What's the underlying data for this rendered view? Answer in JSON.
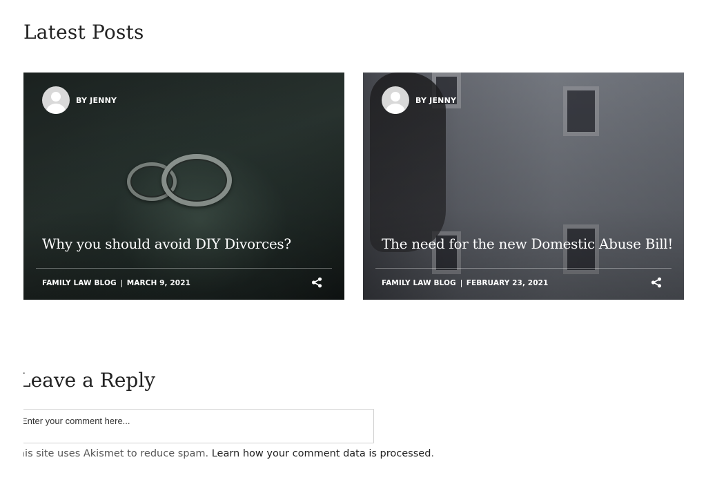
{
  "latest_posts": {
    "heading": "Latest Posts",
    "posts": [
      {
        "author": "BY JENNY",
        "title": "Why you should avoid DIY Divorces?",
        "category": "FAMILY LAW BLOG",
        "date": "MARCH 9, 2021",
        "share_icon": "share-icon"
      },
      {
        "author": "BY JENNY",
        "title": "The need for the new Domestic Abuse Bill!",
        "category": "FAMILY LAW BLOG",
        "date": "FEBRUARY 23, 2021",
        "share_icon": "share-icon"
      }
    ]
  },
  "reply": {
    "heading": "Leave a Reply",
    "comment_placeholder": "Enter your comment here...",
    "akismet_text": "This site uses Akismet to reduce spam. ",
    "akismet_link": "Learn how your comment data is processed",
    "akismet_end": "."
  }
}
